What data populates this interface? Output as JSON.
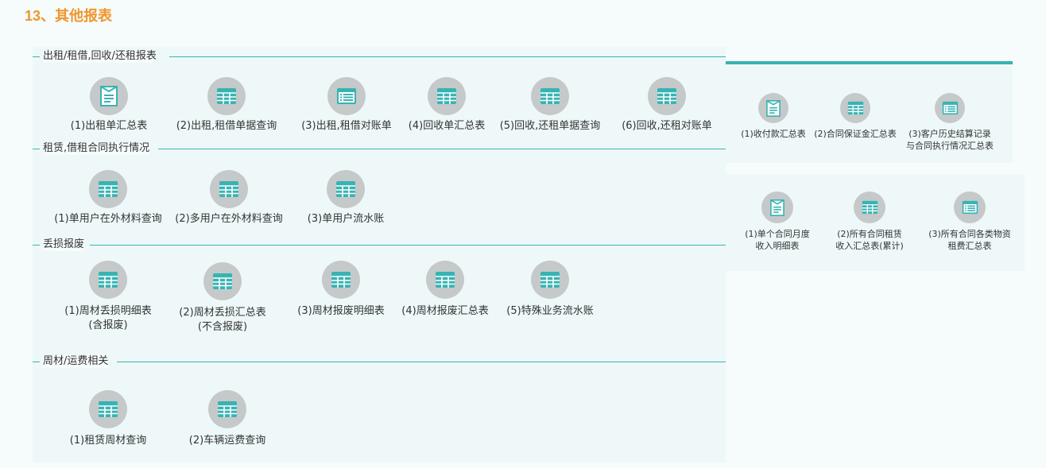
{
  "page_title": "13、其他报表",
  "sections": [
    {
      "label": "出租/租借,回收/还租报表",
      "items": [
        {
          "label": "(1)出租单汇总表",
          "icon": "report-icon"
        },
        {
          "label": "(2)出租,租借单据查询",
          "icon": "table-icon"
        },
        {
          "label": "(3)出租,租借对账单",
          "icon": "list-icon"
        },
        {
          "label": "(4)回收单汇总表",
          "icon": "table-icon"
        },
        {
          "label": "(5)回收,还租单据查询",
          "icon": "table-icon"
        },
        {
          "label": "(6)回收,还租对账单",
          "icon": "table-icon"
        }
      ]
    },
    {
      "label": "租赁,借租合同执行情况",
      "items": [
        {
          "label": "(1)单用户在外材料查询",
          "icon": "table-icon"
        },
        {
          "label": "(2)多用户在外材料查询",
          "icon": "table-icon"
        },
        {
          "label": "(3)单用户流水账",
          "icon": "table-icon"
        }
      ]
    },
    {
      "label": "丢损报废",
      "items": [
        {
          "label": "(1)周材丢损明细表",
          "label2": "(含报废)",
          "icon": "table-icon"
        },
        {
          "label": "(2)周材丢损汇总表",
          "label2": "(不含报废)",
          "icon": "table-icon"
        },
        {
          "label": "(3)周材报废明细表",
          "icon": "table-icon"
        },
        {
          "label": "(4)周材报废汇总表",
          "icon": "table-icon"
        },
        {
          "label": "(5)特殊业务流水账",
          "icon": "table-icon"
        }
      ]
    },
    {
      "label": "周材/运费相关",
      "items": [
        {
          "label": "(1)租赁周材查询",
          "icon": "table-icon"
        },
        {
          "label": "(2)车辆运费查询",
          "icon": "table-icon"
        }
      ]
    }
  ],
  "side_panels": [
    {
      "items": [
        {
          "label": "(1)收付款汇总表",
          "icon": "report-icon"
        },
        {
          "label": "(2)合同保证金汇总表",
          "icon": "table-icon"
        },
        {
          "label": "(3)客户历史结算记录",
          "label2": "与合同执行情况汇总表",
          "icon": "list-icon"
        }
      ]
    },
    {
      "items": [
        {
          "label": "(1)单个合同月度",
          "label2": "收入明细表",
          "icon": "report-icon"
        },
        {
          "label": "(2)所有合同租赁",
          "label2": "收入汇总表(累计)",
          "icon": "table-icon"
        },
        {
          "label": "(3)所有合同各类物资",
          "label2": "租费汇总表",
          "icon": "list-icon"
        }
      ]
    }
  ],
  "colors": {
    "accent": "#38b3b3",
    "title": "#f0962e",
    "icon_bg": "#c5c9ca"
  }
}
